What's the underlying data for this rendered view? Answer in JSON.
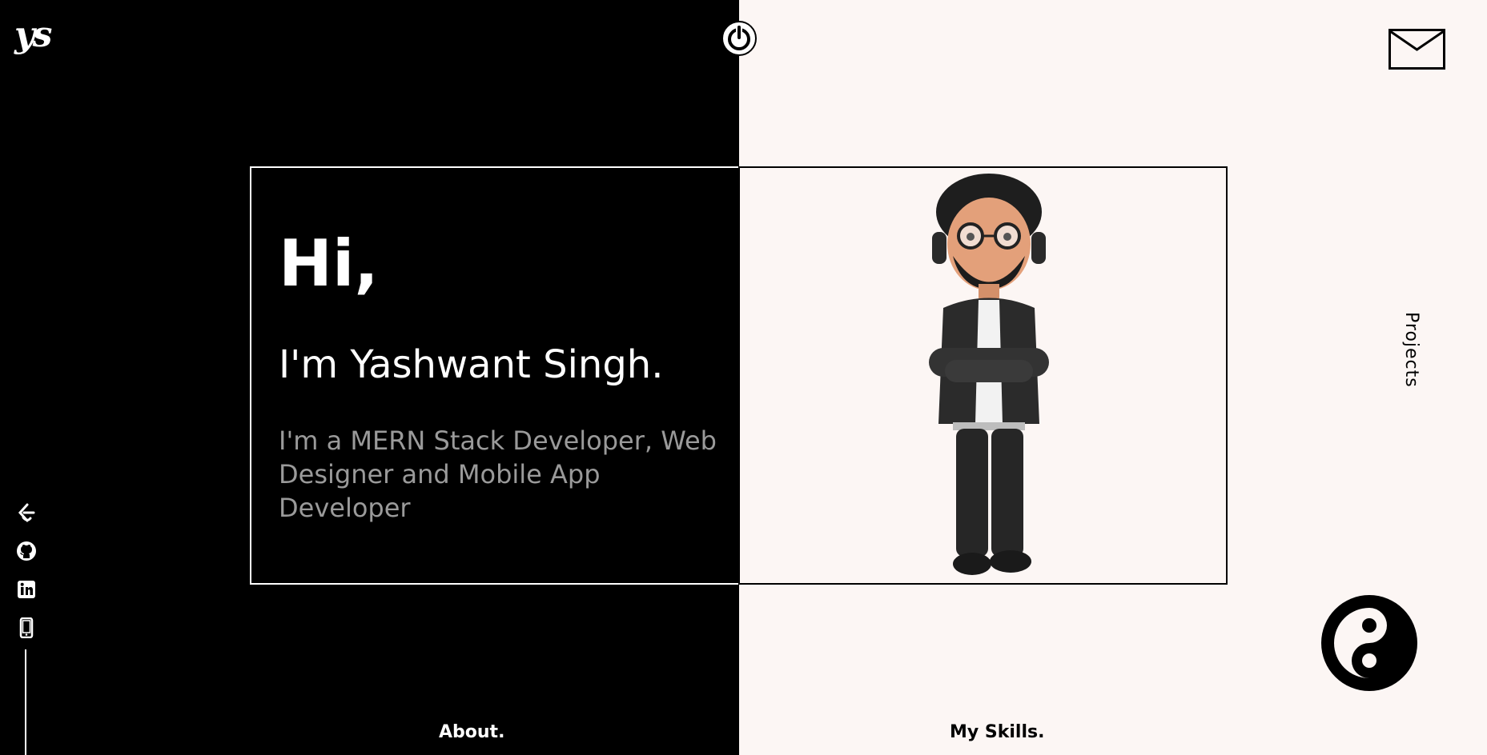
{
  "brand": {
    "logo_text": "ys"
  },
  "hero": {
    "greeting": "Hi,",
    "name_line": "I'm Yashwant Singh.",
    "description": "I'm a MERN Stack Developer, Web Designer and Mobile App Developer"
  },
  "nav": {
    "projects": "Projects",
    "about": "About.",
    "skills": "My Skills."
  },
  "icons": {
    "power": "power-icon",
    "mail": "mail-icon",
    "theme_toggle": "yin-yang-icon",
    "social": [
      "leetcode-icon",
      "github-icon",
      "linkedin-icon",
      "phone-icon"
    ]
  },
  "colors": {
    "dark": "#000000",
    "light": "#fcf6f4",
    "muted_text": "#9a9a9a"
  }
}
